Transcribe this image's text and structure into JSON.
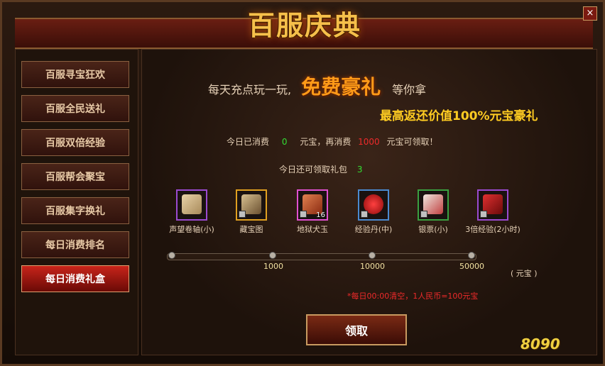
{
  "window": {
    "title": "百服庆典",
    "close_label": "×"
  },
  "sidebar": {
    "items": [
      {
        "label": "百服寻宝狂欢"
      },
      {
        "label": "百服全民送礼"
      },
      {
        "label": "百服双倍经验"
      },
      {
        "label": "百服帮会聚宝"
      },
      {
        "label": "百服集字换礼"
      },
      {
        "label": "每日消费排名"
      },
      {
        "label": "每日消费礼盒",
        "active": true
      }
    ]
  },
  "banner": {
    "prefix": "每天充点玩一玩,",
    "highlight": "免费豪礼",
    "suffix": "等你拿",
    "max_return": "最高返还价值100%元宝豪礼"
  },
  "status": {
    "consumed_label": "今日已消费",
    "consumed_value": "0",
    "consumed_unit": "元宝，再消费",
    "needed_value": "1000",
    "needed_suffix": "元宝可领取！",
    "remain_label": "今日还可领取礼包",
    "remain_value": "3"
  },
  "rewards": [
    {
      "name": "声望卷轴(小)",
      "icon": "scroll-icon"
    },
    {
      "name": "藏宝图",
      "icon": "treasure-map-icon"
    },
    {
      "name": "地狱犬玉",
      "icon": "jade-icon",
      "count": "16"
    },
    {
      "name": "经验丹(中)",
      "icon": "gourd-icon"
    },
    {
      "name": "银票(小)",
      "icon": "banknote-icon"
    },
    {
      "name": "3倍经验(2小时)",
      "icon": "exp-book-icon"
    }
  ],
  "progress": {
    "milestones": [
      "1000",
      "10000",
      "50000"
    ],
    "unit": "( 元宝 )",
    "progress_fraction": 0
  },
  "note": "*每日00:00清空，1人民币=100元宝",
  "claim_button": "领取",
  "watermark": "8090",
  "colors": {
    "accent": "#ff9a18",
    "highlight": "#ffcc22",
    "value_green": "#33dd33",
    "value_red": "#ee2a2a"
  }
}
